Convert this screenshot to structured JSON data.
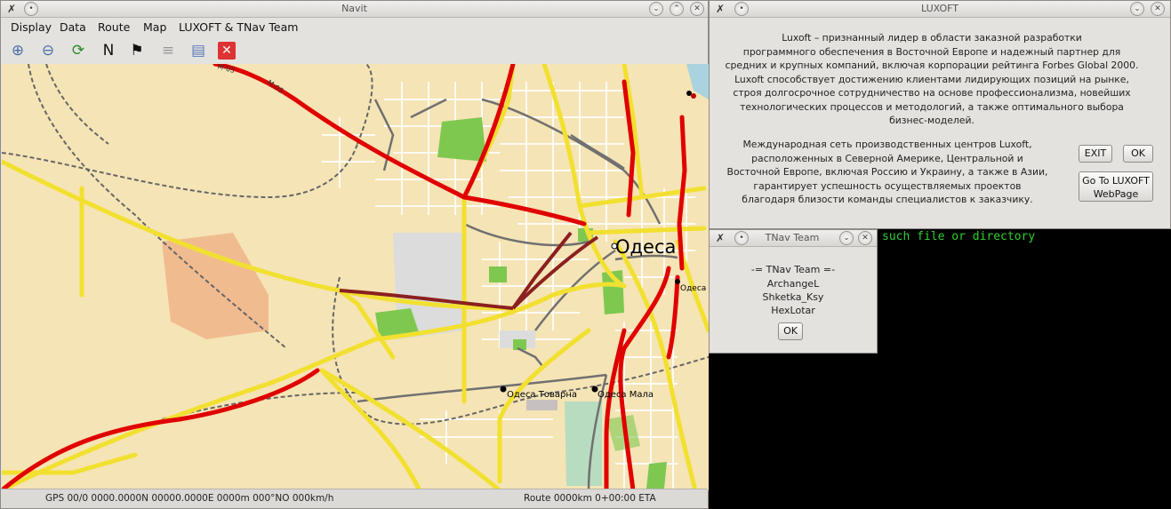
{
  "navit": {
    "title": "Navit",
    "menu": [
      "Display",
      "Data",
      "Route",
      "Map",
      "LUXOFT & TNav Team"
    ],
    "toolbar": [
      {
        "name": "zoom-in-icon",
        "glyph": "⊕"
      },
      {
        "name": "zoom-out-icon",
        "glyph": "⊖"
      },
      {
        "name": "refresh-icon",
        "glyph": "⟳"
      },
      {
        "name": "north-orientation-icon",
        "glyph": "N"
      },
      {
        "name": "destination-flag-icon",
        "glyph": "⚑"
      },
      {
        "name": "list-icon",
        "glyph": "≡"
      },
      {
        "name": "notes-icon",
        "glyph": "▤"
      },
      {
        "name": "quit-icon",
        "glyph": "✕"
      }
    ],
    "map": {
      "city_label": "Одеса",
      "city_label_small": "Одеса",
      "road_label": "M-05",
      "station_1": "Одеса Товарна",
      "station_2": "Одеса Мала"
    },
    "status_left": "GPS 00/0 0000.0000N 00000.0000E 0000m 000°NO 000km/h",
    "status_right": "Route 0000km  0+00:00 ETA"
  },
  "luxoft": {
    "title": "LUXOFT",
    "para1": [
      "Luxoft – признанный лидер в области заказной разработки",
      "программного обеспечения в Восточной Европе и надежный партнер для",
      "средних и крупных компаний, включая корпорации рейтинга Forbes Global 2000.",
      "Luxoft способствует достижению клиентами лидирующих позиций на рынке,",
      "строя долгосрочное сотрудничество на основе профессионализма, новейших",
      "технологических процессов и методологий, а также оптимального выбора",
      "бизнес-моделей."
    ],
    "para2": [
      "Международная сеть производственных центров Luxoft,",
      "расположенных в Северной Америке, Центральной и",
      "Восточной Европе, включая Россию и Украину, а также в Азии,",
      "гарантирует успешность осуществляемых проектов",
      "благодаря близости команды специалистов к заказчику."
    ],
    "exit_label": "EXIT",
    "ok_label": "OK",
    "web_label_1": "Go To LUXOFT",
    "web_label_2": "WebPage"
  },
  "tnav": {
    "title": "TNav Team",
    "heading": "-= TNav Team =-",
    "members": [
      "ArchangeL",
      "Shketka_Ksy",
      "HexLotar"
    ],
    "ok_label": "OK"
  },
  "terminal": {
    "text": "such file or directory"
  },
  "colors": {
    "map_bg": "#f5e4b5",
    "road_main": "#e00000",
    "road_yellow": "#f2e030",
    "park": "#7ec850",
    "terminal_text": "#30d030"
  }
}
